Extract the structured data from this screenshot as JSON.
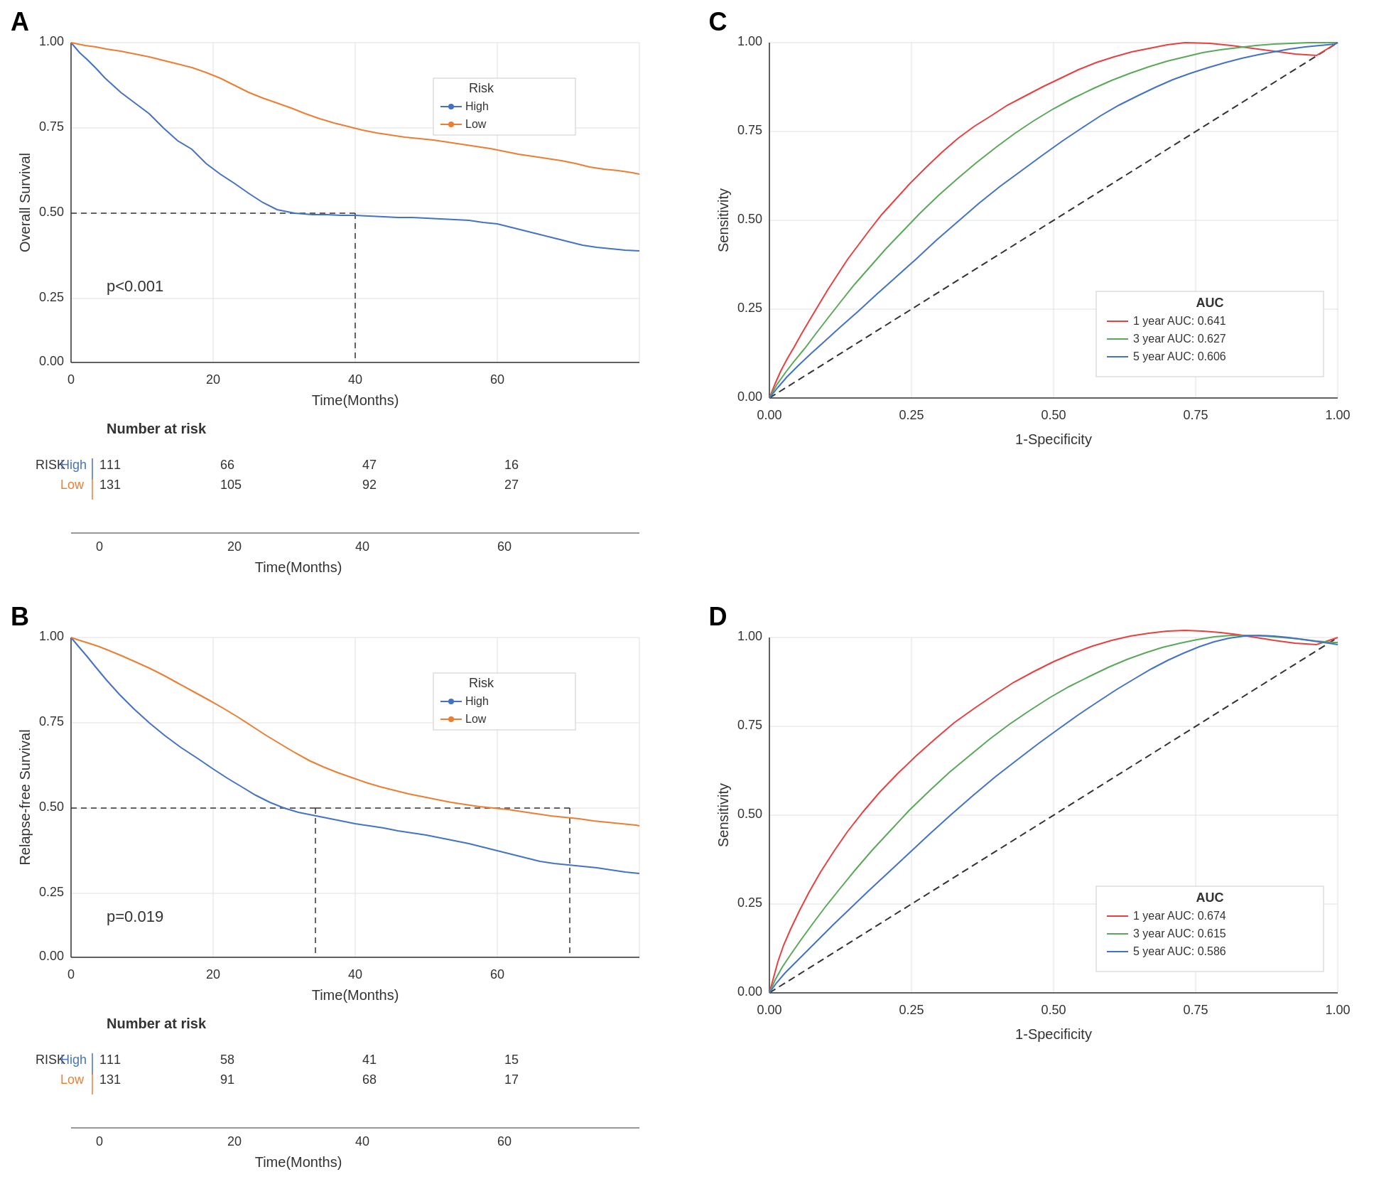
{
  "panels": {
    "A": {
      "label": "A",
      "title": "Overall Survival",
      "xLabel": "Time(Months)",
      "yLabel": "Overall Survival",
      "pValue": "p<0.001",
      "legend": {
        "title": "Risk",
        "high": "High",
        "low": "Low"
      },
      "riskTable": {
        "title": "Number at risk",
        "rows": [
          {
            "label": "High",
            "color": "#4472C4",
            "values": [
              111,
              66,
              47,
              16
            ]
          },
          {
            "label": "Low",
            "color": "#ED7D31",
            "values": [
              131,
              105,
              92,
              27
            ]
          }
        ],
        "xTicks": [
          0,
          20,
          40,
          60
        ]
      }
    },
    "B": {
      "label": "B",
      "title": "Relapse-free Survival",
      "xLabel": "Time(Months)",
      "yLabel": "Relapse-free Survival",
      "pValue": "p=0.019",
      "legend": {
        "title": "Risk",
        "high": "High",
        "low": "Low"
      },
      "riskTable": {
        "title": "Number at risk",
        "rows": [
          {
            "label": "High",
            "color": "#4472C4",
            "values": [
              111,
              58,
              41,
              15
            ]
          },
          {
            "label": "Low",
            "color": "#ED7D31",
            "values": [
              131,
              91,
              68,
              17
            ]
          }
        ],
        "xTicks": [
          0,
          20,
          40,
          60
        ]
      }
    },
    "C": {
      "label": "C",
      "xLabel": "1-Specificity",
      "yLabel": "Sensitivity",
      "legend": {
        "title": "AUC",
        "year1": "1 year AUC: 0.641",
        "year3": "3 year AUC: 0.627",
        "year5": "5 year AUC: 0.606"
      }
    },
    "D": {
      "label": "D",
      "xLabel": "1-Specificity",
      "yLabel": "Sensitivity",
      "legend": {
        "title": "AUC",
        "year1": "1 year AUC: 0.674",
        "year3": "3 year AUC: 0.615",
        "year5": "5 year AUC: 0.586"
      }
    }
  }
}
